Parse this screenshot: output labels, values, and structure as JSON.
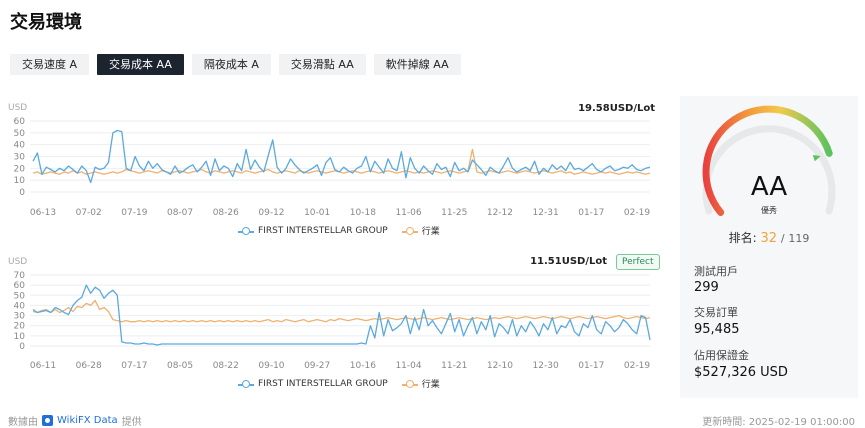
{
  "page_title": "交易環境",
  "tabs": [
    {
      "label": "交易速度 A",
      "active": false
    },
    {
      "label": "交易成本 AA",
      "active": true
    },
    {
      "label": "隔夜成本 A",
      "active": false
    },
    {
      "label": "交易滑點 AA",
      "active": false
    },
    {
      "label": "軟件掉線 AA",
      "active": false
    }
  ],
  "colors": {
    "series_company": "#5aa9df",
    "series_industry": "#f0b070",
    "tab_active": "#1c2430"
  },
  "charts": [
    {
      "value_label": "19.58USD/Lot"
    },
    {
      "value_label": "11.51USD/Lot",
      "badge": "Perfect"
    }
  ],
  "chart_data": [
    {
      "type": "line",
      "ylabel": "USD",
      "ylim": [
        0,
        60
      ],
      "yticks": [
        0,
        10,
        20,
        30,
        40,
        50,
        60
      ],
      "grid": true,
      "legend_position": "bottom-center",
      "xtick_labels": [
        "06-13",
        "07-02",
        "07-19",
        "08-07",
        "08-26",
        "09-12",
        "10-01",
        "10-18",
        "11-06",
        "11-25",
        "12-12",
        "12-31",
        "01-17",
        "02-19"
      ],
      "series": [
        {
          "name": "FIRST INTERSTELLAR GROUP",
          "values": [
            26,
            33,
            15,
            21,
            19,
            17,
            20,
            18,
            22,
            19,
            16,
            22,
            18,
            8,
            21,
            19,
            20,
            25,
            50,
            52,
            51,
            20,
            18,
            30,
            22,
            18,
            26,
            20,
            24,
            19,
            17,
            15,
            22,
            16,
            18,
            21,
            23,
            17,
            21,
            26,
            14,
            28,
            18,
            22,
            20,
            13,
            24,
            18,
            36,
            19,
            27,
            21,
            17,
            31,
            44,
            21,
            16,
            20,
            28,
            23,
            19,
            16,
            18,
            20,
            23,
            14,
            25,
            29,
            19,
            17,
            21,
            18,
            16,
            20,
            22,
            30,
            17,
            26,
            21,
            16,
            28,
            20,
            18,
            34,
            12,
            29,
            20,
            16,
            22,
            18,
            15,
            24,
            19,
            21,
            13,
            25,
            18,
            20,
            17,
            27,
            23,
            19,
            14,
            21,
            18,
            16,
            22,
            29,
            20,
            17,
            19,
            21,
            18,
            26,
            15,
            20,
            17,
            23,
            19,
            22,
            18,
            25,
            19,
            20,
            18,
            21,
            24,
            19,
            17,
            20,
            22,
            18,
            19,
            21,
            20,
            23,
            19,
            18,
            20,
            21
          ]
        },
        {
          "name": "行業",
          "values": [
            16,
            17,
            15,
            16,
            17,
            16,
            15,
            17,
            16,
            18,
            16,
            17,
            15,
            16,
            17,
            16,
            15,
            16,
            17,
            16,
            17,
            19,
            18,
            17,
            16,
            17,
            18,
            17,
            16,
            18,
            17,
            16,
            17,
            18,
            17,
            16,
            17,
            18,
            19,
            17,
            16,
            18,
            17,
            16,
            17,
            18,
            17,
            16,
            18,
            17,
            16,
            17,
            18,
            19,
            17,
            16,
            17,
            18,
            17,
            16,
            18,
            17,
            16,
            17,
            18,
            17,
            16,
            17,
            18,
            17,
            16,
            17,
            18,
            17,
            16,
            17,
            18,
            17,
            16,
            17,
            18,
            17,
            16,
            17,
            18,
            17,
            16,
            17,
            16,
            17,
            18,
            17,
            16,
            17,
            18,
            17,
            16,
            17,
            18,
            36,
            17,
            16,
            17,
            18,
            17,
            16,
            17,
            18,
            17,
            16,
            17,
            18,
            17,
            16,
            17,
            18,
            17,
            16,
            17,
            18,
            16,
            17,
            15,
            16,
            17,
            16,
            15,
            16,
            17,
            16,
            17,
            16,
            15,
            16,
            17,
            16,
            17,
            16,
            15,
            16
          ]
        }
      ]
    },
    {
      "type": "line",
      "ylabel": "USD",
      "ylim": [
        0,
        70
      ],
      "yticks": [
        0,
        10,
        20,
        30,
        40,
        50,
        60,
        70
      ],
      "grid": true,
      "legend_position": "bottom-center",
      "xtick_labels": [
        "06-11",
        "06-28",
        "07-17",
        "08-05",
        "08-22",
        "09-10",
        "09-27",
        "10-16",
        "11-04",
        "11-21",
        "12-10",
        "12-30",
        "01-17",
        "02-19"
      ],
      "series": [
        {
          "name": "FIRST INTERSTELLAR GROUP",
          "values": [
            36,
            33,
            34,
            35,
            33,
            38,
            36,
            33,
            31,
            40,
            45,
            48,
            60,
            52,
            58,
            55,
            47,
            52,
            55,
            50,
            4,
            3,
            3,
            2,
            2,
            3,
            2,
            2,
            1,
            2,
            2,
            2,
            2,
            2,
            2,
            2,
            2,
            2,
            2,
            2,
            2,
            2,
            2,
            2,
            2,
            2,
            2,
            2,
            2,
            2,
            2,
            2,
            2,
            2,
            2,
            2,
            2,
            2,
            2,
            2,
            2,
            2,
            2,
            2,
            2,
            2,
            2,
            2,
            2,
            2,
            2,
            2,
            2,
            2,
            3,
            2,
            20,
            8,
            33,
            10,
            26,
            15,
            18,
            22,
            30,
            12,
            28,
            16,
            36,
            20,
            25,
            18,
            12,
            22,
            32,
            14,
            26,
            10,
            20,
            28,
            12,
            24,
            16,
            30,
            9,
            22,
            18,
            12,
            26,
            10,
            20,
            14,
            24,
            18,
            10,
            22,
            16,
            28,
            12,
            20,
            18,
            26,
            14,
            10,
            22,
            18,
            30,
            16,
            12,
            24,
            20,
            14,
            18,
            26,
            22,
            16,
            12,
            30,
            28,
            6
          ]
        },
        {
          "name": "行業",
          "values": [
            34,
            33,
            35,
            36,
            33,
            36,
            33,
            35,
            38,
            34,
            39,
            38,
            42,
            40,
            45,
            36,
            38,
            34,
            26,
            25,
            24,
            25,
            24,
            24,
            25,
            24,
            25,
            24,
            25,
            24,
            25,
            24,
            25,
            24,
            25,
            24,
            25,
            24,
            25,
            24,
            25,
            24,
            25,
            24,
            25,
            24,
            25,
            24,
            25,
            24,
            25,
            24,
            25,
            26,
            24,
            25,
            24,
            26,
            25,
            24,
            25,
            26,
            24,
            25,
            26,
            25,
            24,
            26,
            25,
            27,
            26,
            25,
            26,
            27,
            26,
            25,
            26,
            27,
            26,
            27,
            28,
            27,
            26,
            27,
            28,
            27,
            26,
            27,
            28,
            27,
            26,
            27,
            28,
            27,
            26,
            27,
            28,
            27,
            26,
            27,
            28,
            27,
            26,
            27,
            28,
            27,
            28,
            29,
            28,
            27,
            28,
            29,
            28,
            27,
            28,
            29,
            28,
            27,
            28,
            29,
            28,
            27,
            28,
            29,
            28,
            27,
            28,
            29,
            28,
            27,
            28,
            29,
            30,
            28,
            27,
            28,
            29,
            28,
            27,
            28
          ]
        }
      ]
    }
  ],
  "gauge": {
    "grade": "AA",
    "description": "優秀",
    "marker_fraction": 0.78
  },
  "rank": {
    "label": "排名:",
    "value": "32",
    "separator": "/",
    "total": "119"
  },
  "stats": [
    {
      "label": "測試用戶",
      "value": "299"
    },
    {
      "label": "交易訂單",
      "value": "95,485"
    },
    {
      "label": "佔用保證金",
      "value": "$527,326 USD"
    }
  ],
  "footer": {
    "source_prefix": "數據由",
    "source_name": "WikiFX Data",
    "source_suffix": "提供",
    "updated_label": "更新時間:",
    "updated_value": "2025-02-19 01:00:00"
  }
}
